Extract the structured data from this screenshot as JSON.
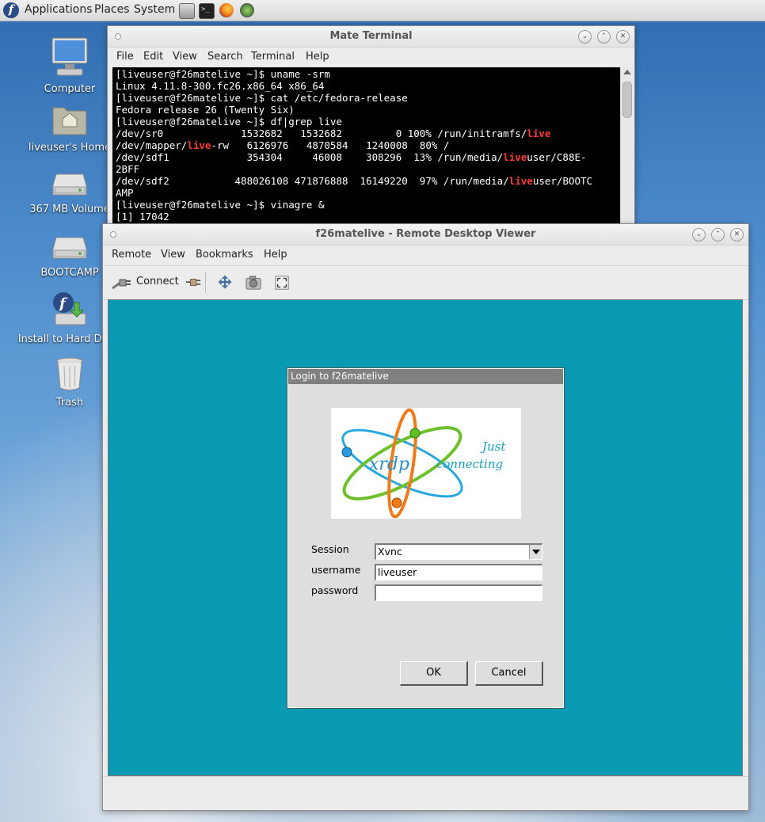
{
  "panel": {
    "menus": [
      "Applications",
      "Places",
      "System"
    ],
    "launchers": [
      "file-manager-icon",
      "terminal-icon",
      "firefox-icon",
      "screenshot-icon"
    ]
  },
  "desktop": {
    "icons": [
      {
        "name": "computer-icon",
        "label": "Computer"
      },
      {
        "name": "home-folder-icon",
        "label": "liveuser's Home"
      },
      {
        "name": "volume-icon",
        "label": "367 MB Volume"
      },
      {
        "name": "bootcamp-drive-icon",
        "label": "BOOTCAMP"
      },
      {
        "name": "install-icon",
        "label": "Install to Hard Drive"
      },
      {
        "name": "trash-icon",
        "label": "Trash"
      }
    ]
  },
  "terminal": {
    "title": "Mate Terminal",
    "menu": [
      "File",
      "Edit",
      "View",
      "Search",
      "Terminal",
      "Help"
    ],
    "lines": [
      [
        {
          "t": "[liveuser@f26matelive ~]$ uname -srm"
        }
      ],
      [
        {
          "t": "Linux 4.11.8-300.fc26.x86_64 x86_64"
        }
      ],
      [
        {
          "t": "[liveuser@f26matelive ~]$ cat /etc/fedora-release"
        }
      ],
      [
        {
          "t": "Fedora release 26 (Twenty Six)"
        }
      ],
      [
        {
          "t": "[liveuser@f26matelive ~]$ df|grep live"
        }
      ],
      [
        {
          "t": "/dev/sr0             1532682   1532682         0 100% /run/initramfs/"
        },
        {
          "t": "live",
          "hl": true
        }
      ],
      [
        {
          "t": "/dev/mapper/"
        },
        {
          "t": "live",
          "hl": true
        },
        {
          "t": "-rw   6126976   4870584   1240008  80% /"
        }
      ],
      [
        {
          "t": "/dev/sdf1             354304     46008    308296  13% /run/media/"
        },
        {
          "t": "live",
          "hl": true
        },
        {
          "t": "user/C88E-"
        }
      ],
      [
        {
          "t": "2BFF"
        }
      ],
      [
        {
          "t": "/dev/sdf2           488026108 471876888  16149220  97% /run/media/"
        },
        {
          "t": "live",
          "hl": true
        },
        {
          "t": "user/BOOTC"
        }
      ],
      [
        {
          "t": "AMP"
        }
      ],
      [
        {
          "t": "[liveuser@f26matelive ~]$ vinagre &"
        }
      ],
      [
        {
          "t": "[1] 17042"
        }
      ]
    ]
  },
  "viewer": {
    "title": "f26matelive - Remote Desktop Viewer",
    "menu": [
      "Remote",
      "View",
      "Bookmarks",
      "Help"
    ],
    "toolbar": {
      "connect_label": "Connect"
    },
    "colors": {
      "remote_bg": "#0899b3"
    }
  },
  "xrdp": {
    "title": "Login to f26matelive",
    "logo": {
      "brand": "xrdp",
      "tagline1": "Just",
      "tagline2": "connecting"
    },
    "session_label": "Session",
    "session_value": "Xvnc",
    "username_label": "username",
    "username_value": "liveuser",
    "password_label": "password",
    "password_value": "",
    "ok_label": "OK",
    "cancel_label": "Cancel"
  }
}
